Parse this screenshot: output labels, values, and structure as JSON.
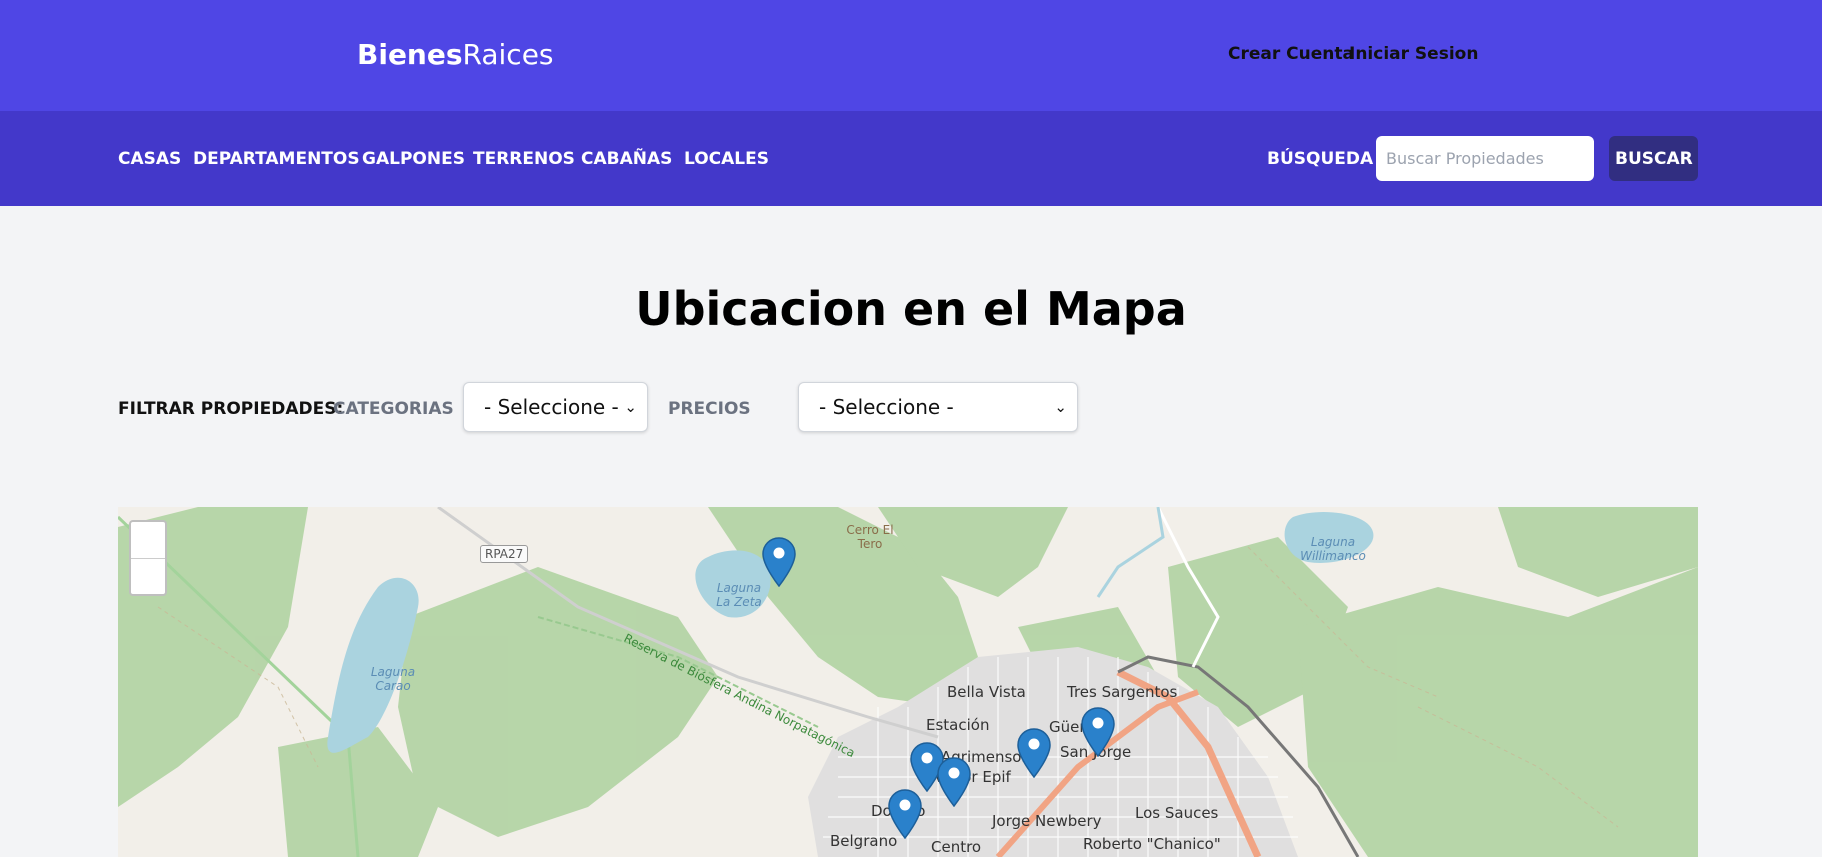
{
  "header": {
    "logo_bold": "Bienes",
    "logo_light": "Raices",
    "crear_cuenta": "Crear Cuenta",
    "iniciar_sesion": "Iniciar Sesion"
  },
  "nav": {
    "items": [
      "CASAS",
      "DEPARTAMENTOS",
      "GALPONES",
      "TERRENOS",
      "CABAÑAS",
      "LOCALES"
    ],
    "search_label": "BÚSQUEDA",
    "search_placeholder": "Buscar Propiedades",
    "search_button": "BUSCAR"
  },
  "main": {
    "title": "Ubicacion en el Mapa"
  },
  "filters": {
    "label": "FILTRAR PROPIEDADES:",
    "categorias_label": "CATEGORIAS",
    "categorias_selected": "- Seleccione -",
    "precios_label": "PRECIOS",
    "precios_selected": "- Seleccione -",
    "chevron_icon": "chevron-down-icon"
  },
  "map": {
    "labels": {
      "rpa27": "RPA27",
      "cerro_el_tero": "Cerro El Tero",
      "laguna_la_zeta": "Laguna La Zeta",
      "laguna_carao": "Laguna Carao",
      "laguna_willimanco": "Laguna Willimanco",
      "reserva": "Reserva de Biósfera Andina Norpatagónica",
      "bella_vista": "Bella Vista",
      "tres_sargentos": "Tres Sargentos",
      "estacion": "Estación",
      "guemes": "Güemes",
      "agrimensor": "Agrimensor",
      "victor_epif": "Victor Epif",
      "san_jorge": "San Jorge",
      "don_bosco": "Don Bo",
      "jorge_newbery": "Jorge Newbery",
      "los_sauces": "Los Sauces",
      "belgrano": "Belgrano",
      "centro": "Centro",
      "roberto_chanico": "Roberto \"Chanico\""
    },
    "marker_icon": "map-marker-icon",
    "marker_color": "#2a81cb"
  },
  "colors": {
    "header_bg": "#4f46e5",
    "nav_bg": "#4338ca",
    "button_bg": "#312e81",
    "page_bg": "#f3f4f6",
    "forest": "#add19e",
    "water": "#aad3df"
  }
}
